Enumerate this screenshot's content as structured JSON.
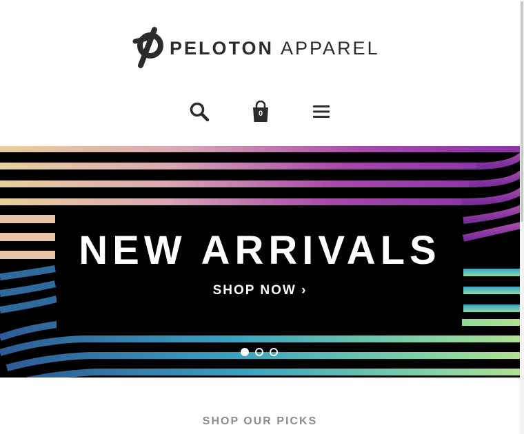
{
  "brand": {
    "name_bold": "PELOTON",
    "name_light": "APPAREL",
    "logo_icon": "peloton-p-logo-icon"
  },
  "header_icons": {
    "search": "search-icon",
    "bag": "shopping-bag-icon",
    "bag_count": "0",
    "menu": "hamburger-menu-icon"
  },
  "hero": {
    "title": "NEW ARRIVALS",
    "cta": "SHOP NOW ›",
    "prev_icon": "chevron-left-icon",
    "next_icon": "chevron-right-icon",
    "slides_total": 3,
    "active_slide": 1,
    "colors": {
      "background": "#000000",
      "gradient_top": [
        "#e8cf9c",
        "#d8a8b4",
        "#a64aa8",
        "#8a36a6"
      ],
      "gradient_bottom": [
        "#2e5b95",
        "#3aa3c0",
        "#7bd0a8",
        "#b0e08f"
      ]
    }
  },
  "sections": {
    "picks_title": "SHOP OUR PICKS"
  }
}
